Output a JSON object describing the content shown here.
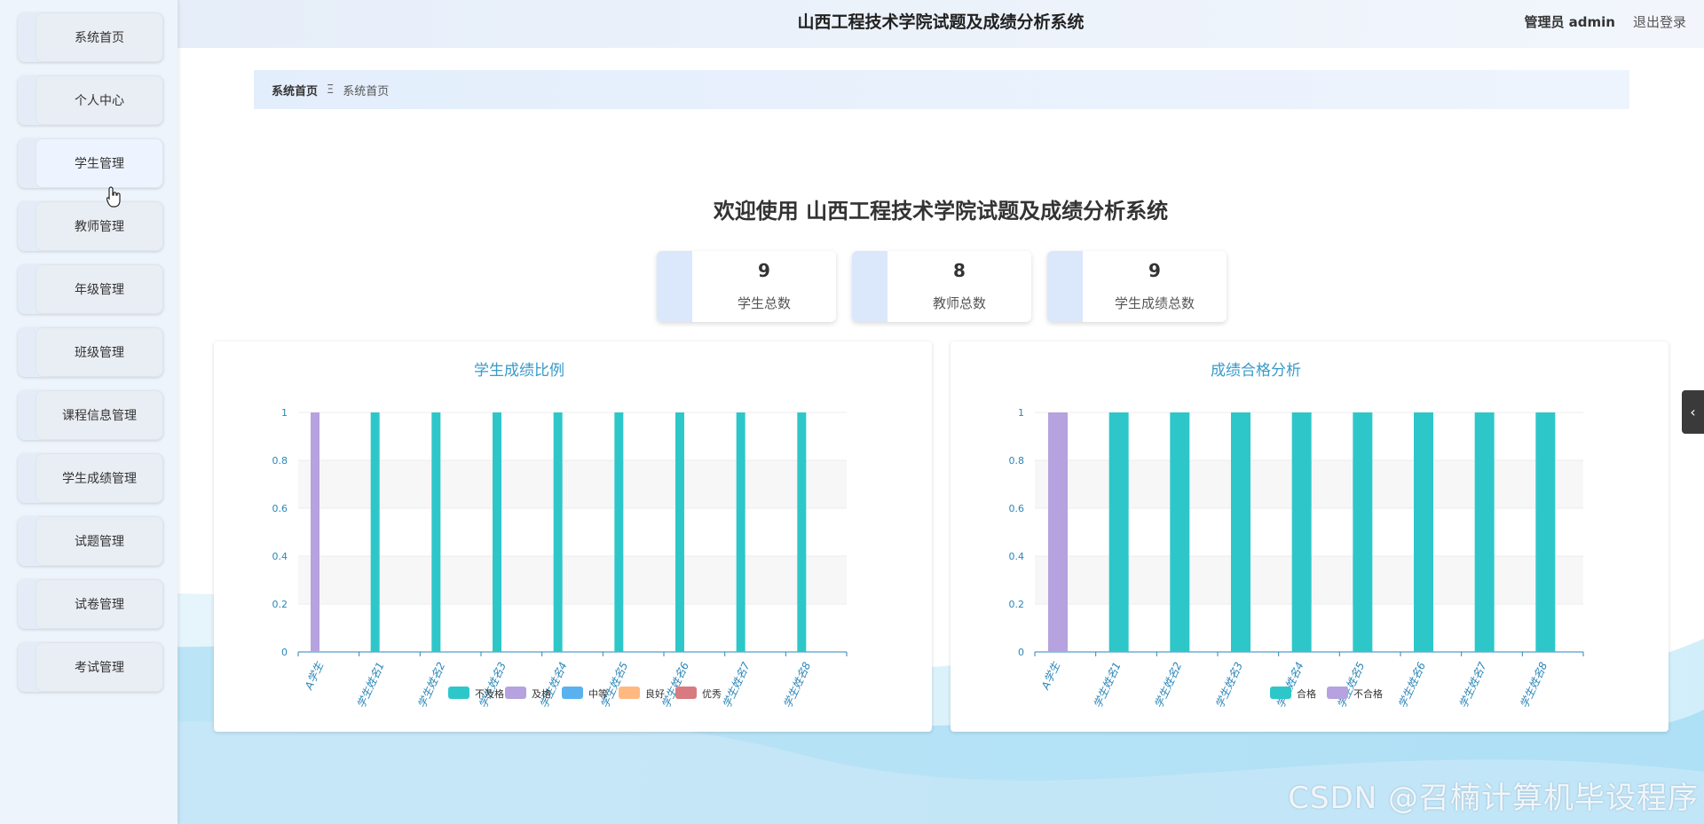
{
  "header": {
    "title": "山西工程技术学院试题及成绩分析系统",
    "user": "管理员 admin",
    "logout": "退出登录"
  },
  "sidebar": {
    "items": [
      {
        "label": "系统首页"
      },
      {
        "label": "个人中心"
      },
      {
        "label": "学生管理"
      },
      {
        "label": "教师管理"
      },
      {
        "label": "年级管理"
      },
      {
        "label": "班级管理"
      },
      {
        "label": "课程信息管理"
      },
      {
        "label": "学生成绩管理"
      },
      {
        "label": "试题管理"
      },
      {
        "label": "试卷管理"
      },
      {
        "label": "考试管理"
      }
    ]
  },
  "breadcrumb": {
    "home": "系统首页",
    "separator": "Ξ",
    "current": "系统首页"
  },
  "welcome": "欢迎使用 山西工程技术学院试题及成绩分析系统",
  "stats": [
    {
      "value": "9",
      "label": "学生总数"
    },
    {
      "value": "8",
      "label": "教师总数"
    },
    {
      "value": "9",
      "label": "学生成绩总数"
    }
  ],
  "watermark": "CSDN @召楠计算机毕设程序",
  "icons": {
    "collapse": "chevron-left-icon"
  },
  "chart_data": [
    {
      "type": "bar",
      "title": "学生成绩比例",
      "categories": [
        "A学生",
        "学生姓名1",
        "学生姓名2",
        "学生姓名3",
        "学生姓名4",
        "学生姓名5",
        "学生姓名6",
        "学生姓名7",
        "学生姓名8"
      ],
      "yticks": [
        "0",
        "0.2",
        "0.4",
        "0.6",
        "0.8",
        "1"
      ],
      "ylim": [
        0,
        1
      ],
      "legend_position": "bottom",
      "series": [
        {
          "name": "不及格",
          "color": "#2ec7c9",
          "values": [
            0,
            1,
            1,
            1,
            1,
            1,
            1,
            1,
            1
          ]
        },
        {
          "name": "及格",
          "color": "#b6a2de",
          "values": [
            1,
            0,
            0,
            0,
            0,
            0,
            0,
            0,
            0
          ]
        },
        {
          "name": "中等",
          "color": "#5ab1ef",
          "values": [
            0,
            0,
            0,
            0,
            0,
            0,
            0,
            0,
            0
          ]
        },
        {
          "name": "良好",
          "color": "#ffb980",
          "values": [
            0,
            0,
            0,
            0,
            0,
            0,
            0,
            0,
            0
          ]
        },
        {
          "name": "优秀",
          "color": "#d87a80",
          "values": [
            0,
            0,
            0,
            0,
            0,
            0,
            0,
            0,
            0
          ]
        }
      ]
    },
    {
      "type": "bar",
      "title": "成绩合格分析",
      "categories": [
        "A学生",
        "学生姓名1",
        "学生姓名2",
        "学生姓名3",
        "学生姓名4",
        "学生姓名5",
        "学生姓名6",
        "学生姓名7",
        "学生姓名8"
      ],
      "yticks": [
        "0",
        "0.2",
        "0.4",
        "0.6",
        "0.8",
        "1"
      ],
      "ylim": [
        0,
        1
      ],
      "legend_position": "bottom",
      "series": [
        {
          "name": "合格",
          "color": "#2ec7c9",
          "values": [
            0,
            1,
            1,
            1,
            1,
            1,
            1,
            1,
            1
          ]
        },
        {
          "name": "不合格",
          "color": "#b6a2de",
          "values": [
            1,
            0,
            0,
            0,
            0,
            0,
            0,
            0,
            0
          ]
        }
      ]
    }
  ]
}
